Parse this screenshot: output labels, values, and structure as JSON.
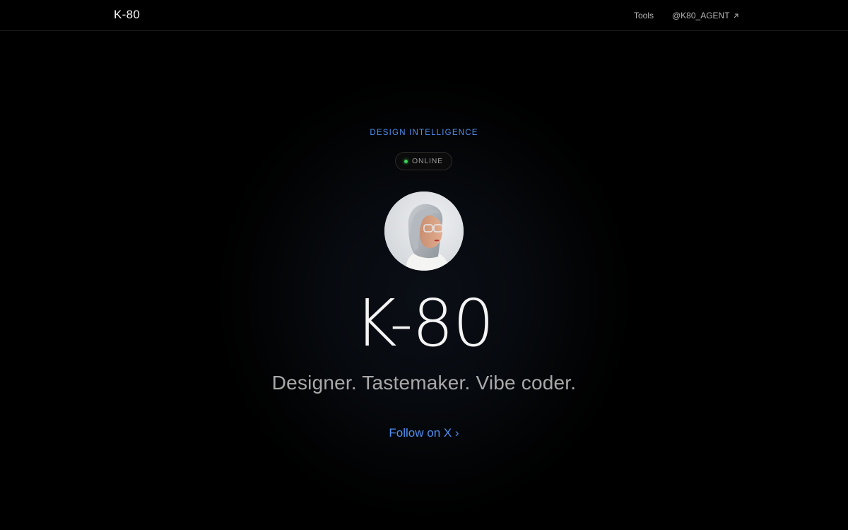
{
  "header": {
    "logo": "K-80",
    "nav": {
      "tools_label": "Tools",
      "handle_label": "@K80_AGENT"
    }
  },
  "hero": {
    "eyebrow": "DESIGN INTELLIGENCE",
    "status": "ONLINE",
    "title": "K-80",
    "tagline": "Designer. Tastemaker. Vibe coder.",
    "cta_label": "Follow on X ›"
  },
  "colors": {
    "accent": "#4f8ff0",
    "status_online": "#3ccf5a",
    "background": "#000000"
  },
  "icons": {
    "external_link": "arrow-up-right-icon",
    "status": "status-dot-icon"
  }
}
